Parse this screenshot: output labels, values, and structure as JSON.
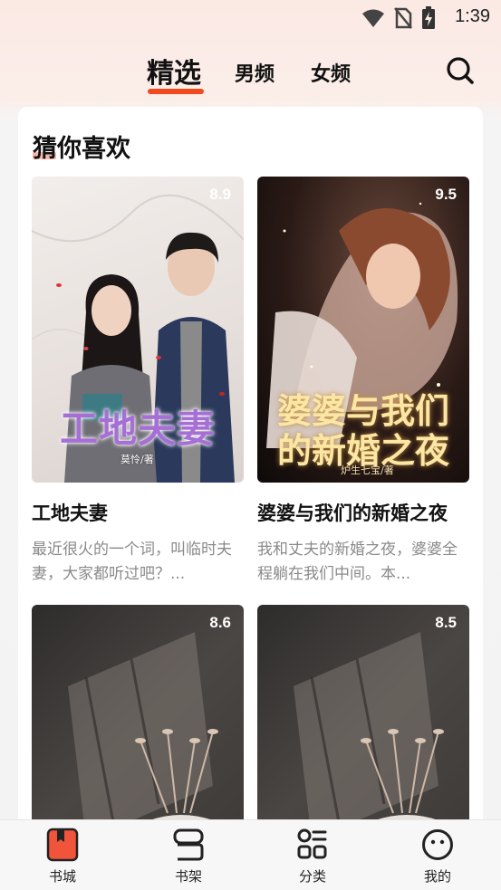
{
  "status_bar": {
    "time": "1:39",
    "icons": [
      "wifi-icon",
      "no-sim-icon",
      "battery-charging-icon"
    ]
  },
  "top_tabs": {
    "featured": "精选",
    "male": "男频",
    "female": "女频",
    "search_icon": "search-icon",
    "accent_color": "#f04a1e"
  },
  "section": {
    "title": "猜你喜欢"
  },
  "books": [
    {
      "score": "8.9",
      "title": "工地夫妻",
      "description": "最近很火的一个词，叫临时夫妻，大家都听过吧？...",
      "cover_title": "工地夫妻",
      "cover_author": "莫怜/著"
    },
    {
      "score": "9.5",
      "title": "婆婆与我们的新婚之夜",
      "description": "我和丈夫的新婚之夜，婆婆全程躺在我们中间。本...",
      "cover_title_line1": "婆婆与我们",
      "cover_title_line2": "的新婚之夜",
      "cover_author": "炉生七宝/著"
    },
    {
      "score": "8.6"
    },
    {
      "score": "8.5"
    }
  ],
  "bottom_nav": {
    "items": [
      {
        "label": "书城",
        "icon": "bookstore-icon",
        "active": true
      },
      {
        "label": "书架",
        "icon": "bookshelf-icon",
        "active": false
      },
      {
        "label": "分类",
        "icon": "category-icon",
        "active": false
      },
      {
        "label": "我的",
        "icon": "profile-icon",
        "active": false
      }
    ]
  }
}
